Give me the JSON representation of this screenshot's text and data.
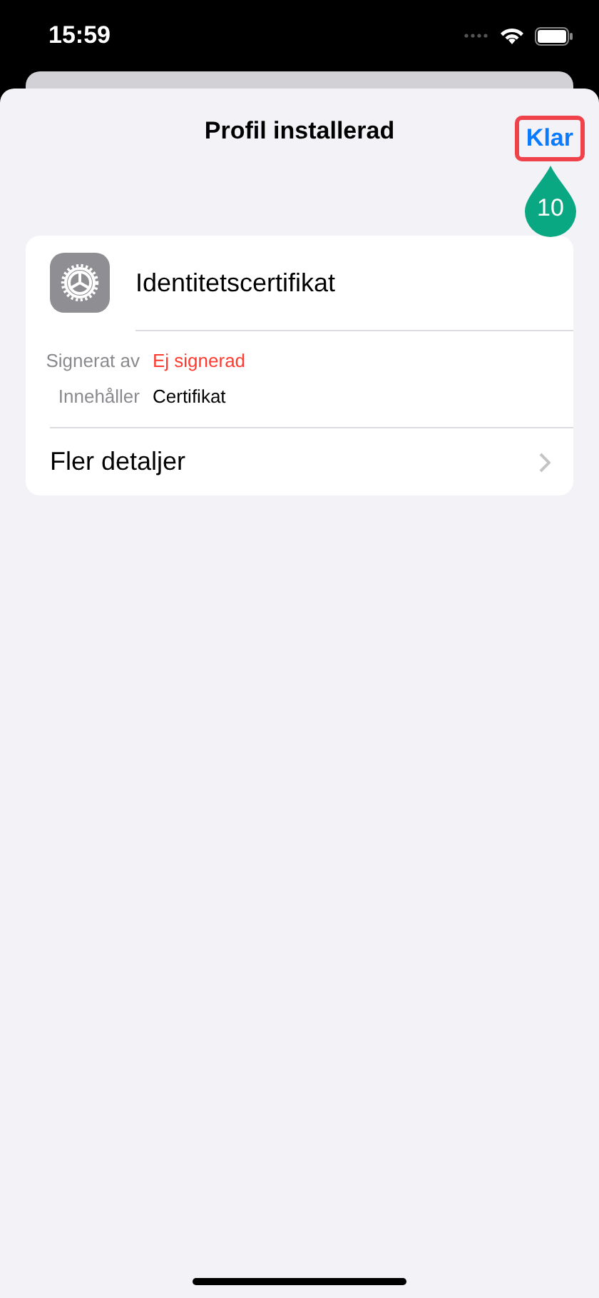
{
  "status_bar": {
    "time": "15:59"
  },
  "sheet": {
    "title": "Profil installerad",
    "done_button": {
      "label": "Klar",
      "highlighted": true
    },
    "step_marker": "10"
  },
  "profile": {
    "name": "Identitetscertifikat",
    "details": [
      {
        "label": "Signerat av",
        "value": "Ej signerad",
        "kind": "alert"
      },
      {
        "label": "Innehåller",
        "value": "Certifikat",
        "kind": "plain"
      }
    ],
    "more_link": "Fler detaljer"
  }
}
